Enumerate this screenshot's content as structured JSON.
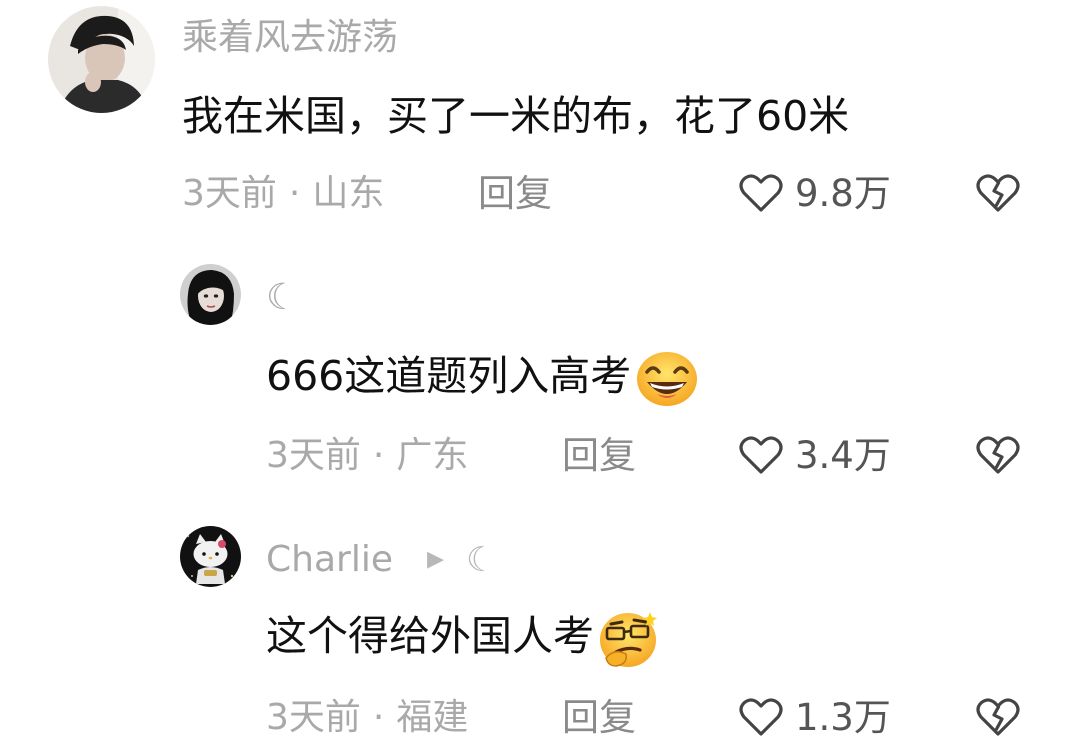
{
  "comments": [
    {
      "username": "乘着风去游荡",
      "text": "我在米国，买了一米的布，花了60米",
      "time": "3天前",
      "location": "山东",
      "reply_label": "回复",
      "likes": "9.8万",
      "avatar_icon": "user-avatar",
      "like_icon": "heart-icon",
      "dislike_icon": "broken-heart-icon"
    },
    {
      "username": "☾",
      "text": "666这道题列入高考",
      "emoji": "grinning-face-emoji",
      "time": "3天前",
      "location": "广东",
      "reply_label": "回复",
      "likes": "3.4万",
      "avatar_icon": "user-avatar",
      "like_icon": "heart-icon",
      "dislike_icon": "broken-heart-icon"
    },
    {
      "username": "Charlie",
      "badge_play": "▸",
      "badge_moon": "☾",
      "text": "这个得给外国人考",
      "emoji": "thinking-glasses-face-emoji",
      "time": "3天前",
      "location": "福建",
      "reply_label": "回复",
      "likes": "1.3万",
      "avatar_icon": "hello-kitty-avatar",
      "like_icon": "heart-icon",
      "dislike_icon": "broken-heart-icon"
    }
  ],
  "colors": {
    "username": "#a9a9a9",
    "text": "#111111",
    "meta": "#a9a9a9",
    "icon_stroke": "#444444"
  }
}
